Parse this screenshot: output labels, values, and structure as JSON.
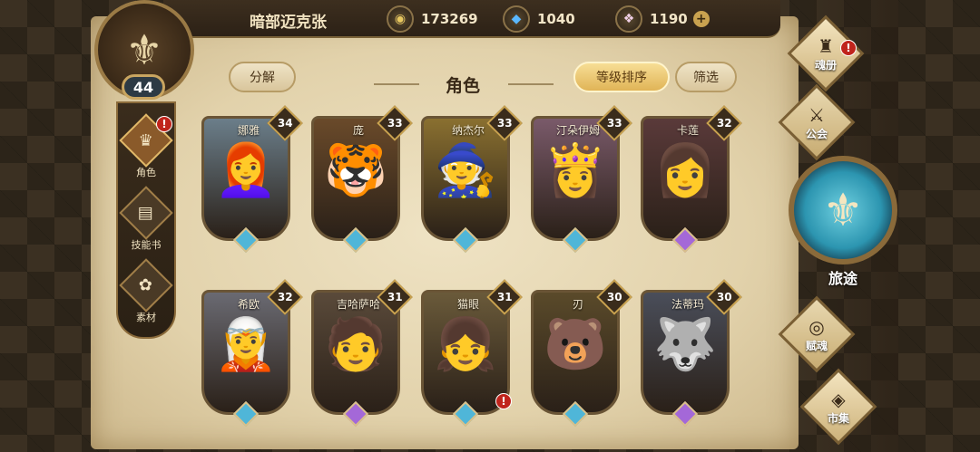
{
  "header": {
    "player_name": "暗部迈克张",
    "level": "44",
    "resources": [
      {
        "icon": "coin-icon",
        "value": "173269"
      },
      {
        "icon": "crystal-icon",
        "value": "1040"
      },
      {
        "icon": "gem-icon",
        "value": "1190"
      }
    ],
    "plus_label": "+"
  },
  "left_nav": [
    {
      "label": "角色",
      "icon": "helmet-icon",
      "active": true,
      "alert": "!"
    },
    {
      "label": "技能书",
      "icon": "book-icon",
      "active": false
    },
    {
      "label": "素材",
      "icon": "material-icon",
      "active": false
    }
  ],
  "toolbar": {
    "decompose_label": "分解",
    "title": "角色",
    "sort_label": "等级排序",
    "filter_label": "筛选"
  },
  "cards": [
    {
      "name": "娜雅",
      "level": "34",
      "emoji": "👩‍🦰",
      "bg": "#6b7e8a",
      "gem_color": "#4fb6d8"
    },
    {
      "name": "庞",
      "level": "33",
      "emoji": "🐯",
      "bg": "#6a4a2a",
      "gem_color": "#4fb6d8"
    },
    {
      "name": "纳杰尔",
      "level": "33",
      "emoji": "🧙",
      "bg": "#8a7030",
      "gem_color": "#4fb6d8"
    },
    {
      "name": "汀朵伊姆",
      "level": "33",
      "emoji": "👸",
      "bg": "#7a5a6a",
      "gem_color": "#4fb6d8"
    },
    {
      "name": "卡莲",
      "level": "32",
      "emoji": "👩",
      "bg": "#5a3a3a",
      "gem_color": "#a468d8"
    },
    {
      "name": "希欧",
      "level": "32",
      "emoji": "🧝",
      "bg": "#6a6a72",
      "gem_color": "#4fb6d8"
    },
    {
      "name": "吉哈萨哈",
      "level": "31",
      "emoji": "🧑",
      "bg": "#5a4a3a",
      "gem_color": "#a468d8"
    },
    {
      "name": "猫眼",
      "level": "31",
      "emoji": "👧",
      "bg": "#6a5a3a",
      "gem_color": "#4fb6d8",
      "alert": "!"
    },
    {
      "name": "刃",
      "level": "30",
      "emoji": "🐻",
      "bg": "#5a4a2a",
      "gem_color": "#4fb6d8"
    },
    {
      "name": "法蒂玛",
      "level": "30",
      "emoji": "🐺",
      "bg": "#4a4e5a",
      "gem_color": "#a468d8"
    }
  ],
  "right_nav": [
    {
      "label": "魂册",
      "icon": "soul-book-icon",
      "alert": "!"
    },
    {
      "label": "公会",
      "icon": "guild-icon"
    },
    {
      "label": "旅途",
      "icon": "journey-icon"
    },
    {
      "label": "赋魂",
      "icon": "spirit-icon"
    },
    {
      "label": "市集",
      "icon": "market-icon"
    }
  ]
}
